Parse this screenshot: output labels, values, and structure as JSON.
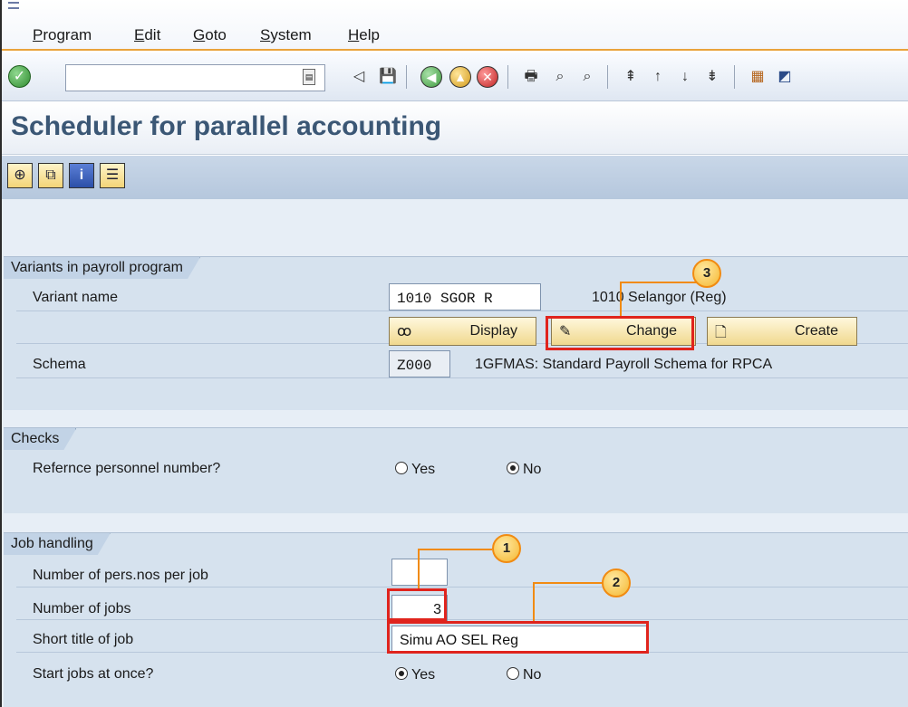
{
  "menu": [
    "Program",
    "Edit",
    "Goto",
    "System",
    "Help"
  ],
  "toolbar": {
    "command_value": ""
  },
  "title": "Scheduler for parallel accounting",
  "sections": {
    "variants": {
      "title": "Variants in payroll program",
      "variant_label": "Variant name",
      "variant_value": "1010 SGOR R",
      "variant_desc": "1010 Selangor (Reg)",
      "display_label": "Display",
      "change_label": "Change",
      "create_label": "Create",
      "schema_label": "Schema",
      "schema_value": "Z000",
      "schema_desc": "1GFMAS: Standard Payroll Schema for RPCA"
    },
    "checks": {
      "title": "Checks",
      "ref_label": "Refernce personnel number?",
      "yes": "Yes",
      "no": "No",
      "selected": "No"
    },
    "jobs": {
      "title": "Job handling",
      "pers_label": "Number of pers.nos per job",
      "pers_value": "",
      "jobs_label": "Number of jobs",
      "jobs_value": "3",
      "short_label": "Short title of job",
      "short_value": "Simu AO SEL Reg",
      "start_label": "Start jobs at once?",
      "yes": "Yes",
      "no": "No",
      "selected": "Yes"
    }
  },
  "callouts": [
    "1",
    "2",
    "3"
  ],
  "colors": {
    "highlight": "#e0241d",
    "callout": "#f18b12",
    "title": "#3b5775"
  }
}
